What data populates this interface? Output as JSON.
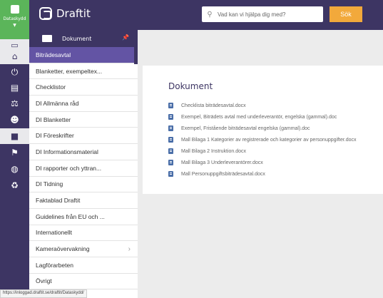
{
  "brand": {
    "rail_label": "Dataskydd",
    "app_name": "Draftit"
  },
  "search": {
    "placeholder": "Vad kan vi hjälpa dig med?",
    "button": "Sök"
  },
  "panel": {
    "title": "Dokument",
    "items": [
      {
        "label": "Biträdesavtal",
        "active": true
      },
      {
        "label": "Blanketter, exempeltex..."
      },
      {
        "label": "Checklistor"
      },
      {
        "label": "DI Allmänna råd"
      },
      {
        "label": "DI Blanketter"
      },
      {
        "label": "DI Föreskrifter"
      },
      {
        "label": "DI Informationsmaterial"
      },
      {
        "label": "DI rapporter och yttran..."
      },
      {
        "label": "DI Tidning"
      },
      {
        "label": "Faktablad Draftit"
      },
      {
        "label": "Guidelines från EU och ..."
      },
      {
        "label": "Internationellt"
      },
      {
        "label": "Kameraövervakning",
        "has_children": true
      },
      {
        "label": "Lagförarbeten"
      },
      {
        "label": "Övrigt"
      }
    ]
  },
  "main": {
    "heading": "Dokument",
    "files": [
      "Checklista biträdesavtal.docx",
      "Exempel, Biträdets avtal med underleverantör, engelska (gammal).doc",
      "Exempel, Fristående biträdesavtal engelska (gammal).doc",
      "Mall Bilaga 1 Kategorier av registrerade och kategorier av personuppgifter.docx",
      "Mall Bilaga 2 Instruktion.docx",
      "Mall Bilaga 3 Underleverantörer.docx",
      "Mall Personuppgiftsbiträdesavtal.docx"
    ]
  },
  "status_url": "https://inloggad.draftit.se/draftit/Dataskydd/",
  "colors": {
    "nav": "#3d3563",
    "active": "#6354a4",
    "brand_green": "#5bb55a",
    "search_button": "#f2a93b"
  },
  "rail_icons": [
    "monitor-icon",
    "building-icon",
    "power-icon",
    "clipboard-icon",
    "gavel-icon",
    "users-icon",
    "folder-icon",
    "flag-icon",
    "globe-icon",
    "recycle-icon"
  ]
}
